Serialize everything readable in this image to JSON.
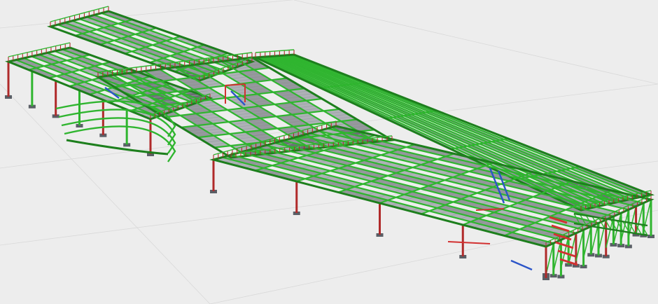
{
  "viewport": {
    "background": "#ededed",
    "grid_color": "#d9d9d9"
  },
  "model": {
    "type": "steel-frame-3d",
    "colors": {
      "primary_beam": "#2fb52f",
      "primary_beam_dark": "#1d7f1d",
      "deck": "#4a4f55",
      "deck_light": "#7a8088",
      "column": "#b02a2a",
      "brace_red": "#d23131",
      "brace_blue": "#2c55c8",
      "footing": "#5a5f66"
    }
  }
}
